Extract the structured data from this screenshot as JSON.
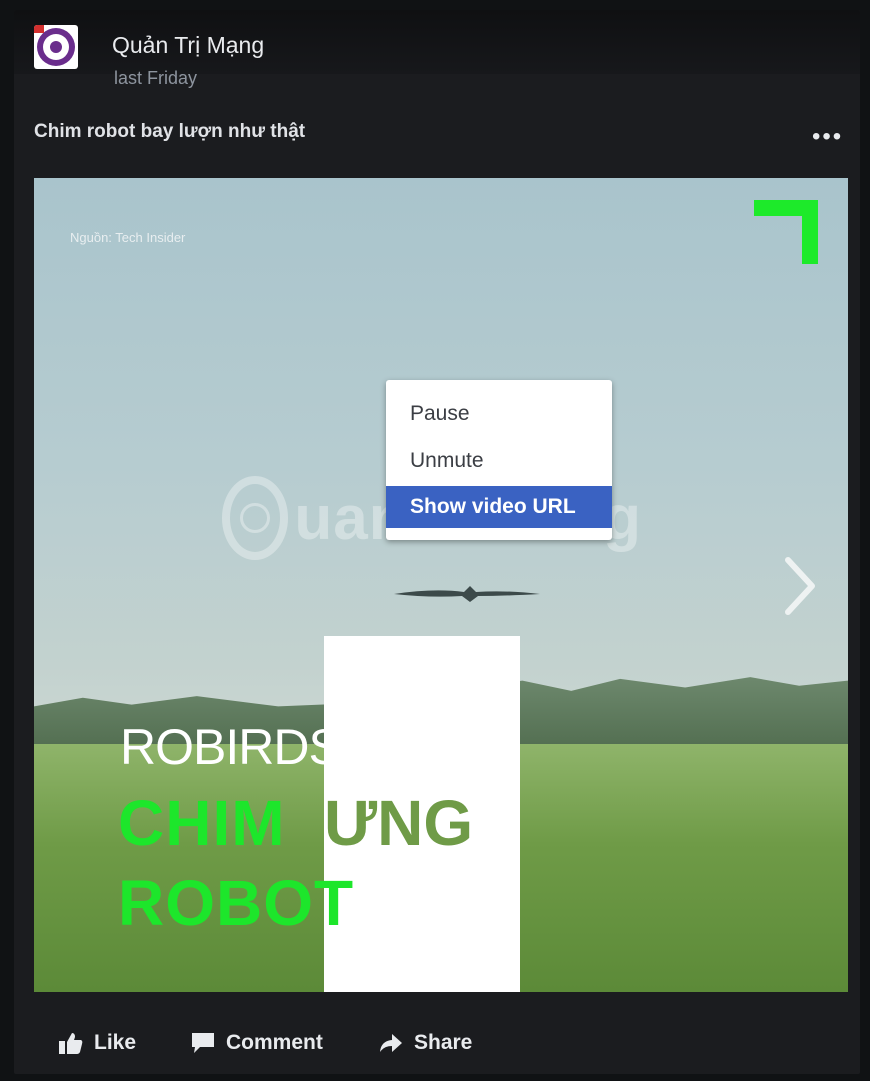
{
  "post": {
    "page_name": "Quản Trị Mạng",
    "time": "last Friday",
    "caption": "Chim robot bay lượn như thật",
    "more_label": "•••"
  },
  "video": {
    "source_label": "Nguồn: Tech Insider",
    "watermark": "uantrimang",
    "title_line1": "ROBIRDS",
    "title_line2a": "CHIM",
    "title_line2b": "ƯNG",
    "title_line3": "ROBOT",
    "accent_color": "#1dea2a"
  },
  "context_menu": {
    "items": [
      {
        "label": "Pause"
      },
      {
        "label": "Unmute"
      },
      {
        "label": "Show video URL"
      }
    ]
  },
  "actions": {
    "like": "Like",
    "comment": "Comment",
    "share": "Share"
  },
  "icons": {
    "avatar": "quantrimang-logo",
    "like": "thumbs-up-icon",
    "comment": "speech-bubble-icon",
    "share": "share-arrow-icon",
    "next": "chevron-right-icon"
  }
}
